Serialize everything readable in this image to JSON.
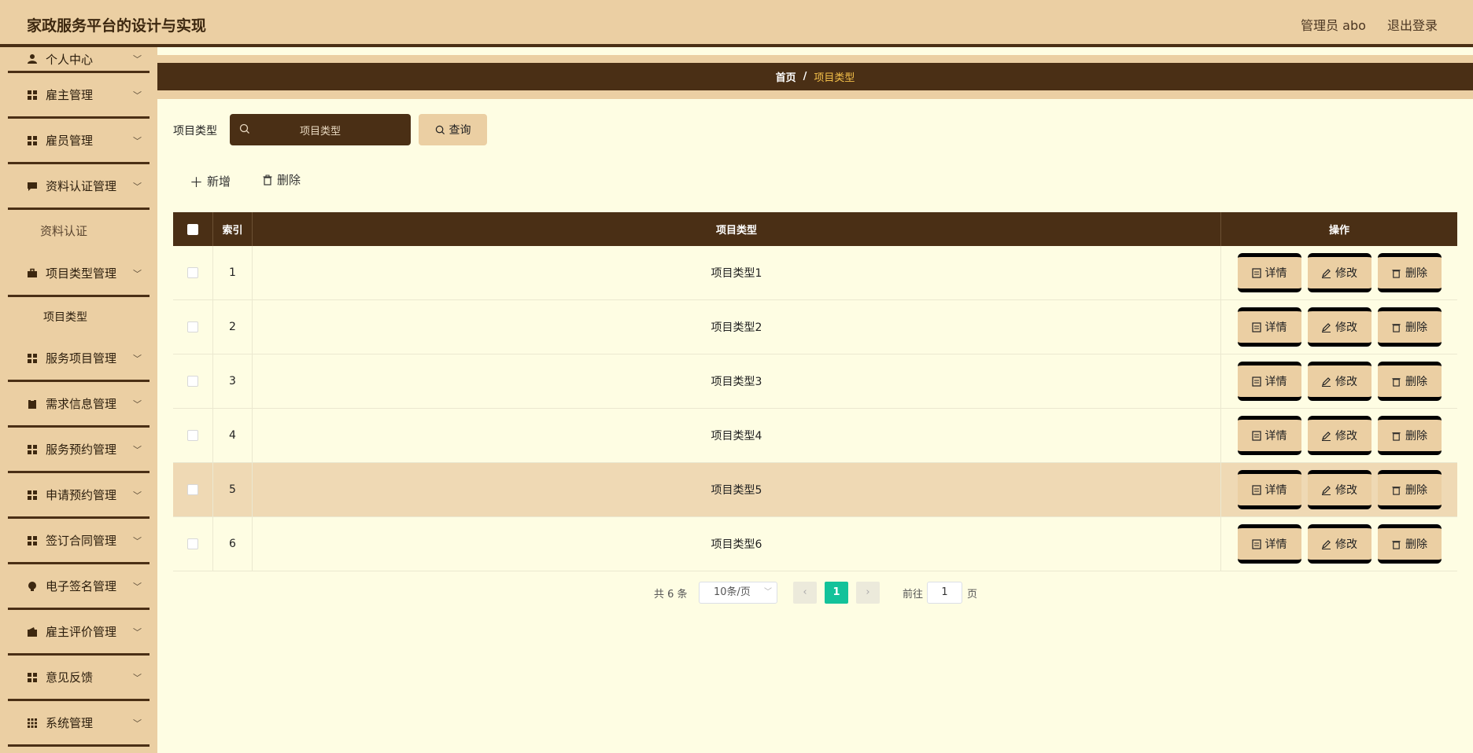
{
  "header": {
    "title": "家政服务平台的设计与实现",
    "user_label": "管理员 abo",
    "logout_label": "退出登录"
  },
  "sidebar": {
    "items": [
      {
        "label": "个人中心",
        "icon": "user-icon"
      },
      {
        "label": "雇主管理",
        "icon": "grid-icon"
      },
      {
        "label": "雇员管理",
        "icon": "grid-icon"
      },
      {
        "label": "资料认证管理",
        "icon": "chat-icon",
        "sub": [
          "资料认证"
        ]
      },
      {
        "label": "项目类型管理",
        "icon": "briefcase-icon",
        "sub": [
          "项目类型"
        ]
      },
      {
        "label": "服务项目管理",
        "icon": "grid-icon"
      },
      {
        "label": "需求信息管理",
        "icon": "clipboard-icon"
      },
      {
        "label": "服务预约管理",
        "icon": "grid-icon"
      },
      {
        "label": "申请预约管理",
        "icon": "grid-icon"
      },
      {
        "label": "签订合同管理",
        "icon": "grid-icon"
      },
      {
        "label": "电子签名管理",
        "icon": "bulb-icon"
      },
      {
        "label": "雇主评价管理",
        "icon": "wallet-icon"
      },
      {
        "label": "意见反馈",
        "icon": "grid-icon"
      },
      {
        "label": "系统管理",
        "icon": "grid9-icon"
      }
    ]
  },
  "breadcrumb": {
    "home": "首页",
    "separator": "/",
    "current": "项目类型"
  },
  "search": {
    "label": "项目类型",
    "placeholder": "项目类型",
    "button_label": "查询"
  },
  "actions": {
    "add_label": "新增",
    "delete_label": "删除"
  },
  "table": {
    "headers": {
      "index": "索引",
      "type": "项目类型",
      "ops": "操作"
    },
    "op_labels": {
      "detail": "详情",
      "edit": "修改",
      "delete": "删除"
    },
    "rows": [
      {
        "index": "1",
        "type": "项目类型1"
      },
      {
        "index": "2",
        "type": "项目类型2"
      },
      {
        "index": "3",
        "type": "项目类型3"
      },
      {
        "index": "4",
        "type": "项目类型4"
      },
      {
        "index": "5",
        "type": "项目类型5"
      },
      {
        "index": "6",
        "type": "项目类型6"
      }
    ]
  },
  "pagination": {
    "total": "共 6 条",
    "page_size": "10条/页",
    "current_page": "1",
    "goto_label": "前往",
    "goto_value": "1",
    "page_suffix": "页"
  },
  "colors": {
    "accent": "#4a2f15",
    "bar": "#ebcfa3",
    "background": "#fefde3",
    "page_active": "#13c29a"
  }
}
